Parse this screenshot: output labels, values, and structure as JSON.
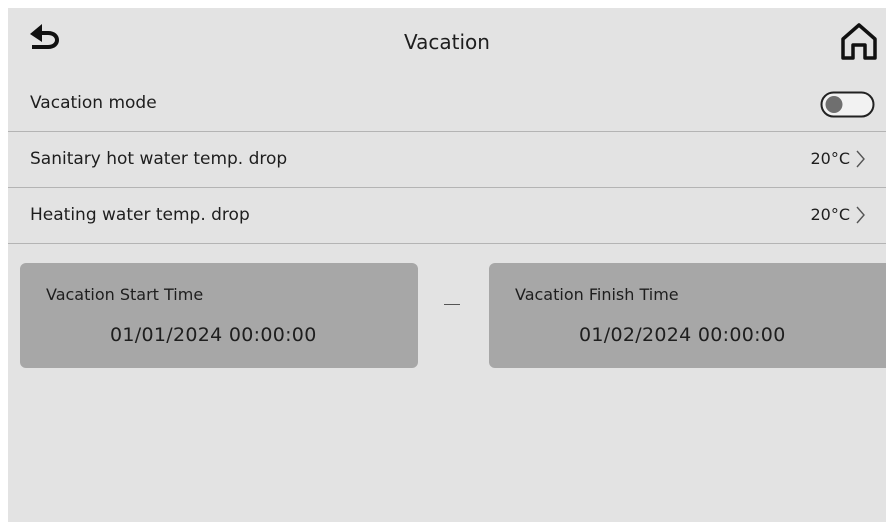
{
  "header": {
    "title": "Vacation",
    "back_icon": "back-arrow-icon",
    "home_icon": "home-icon"
  },
  "settings": [
    {
      "label": "Vacation mode",
      "type": "toggle",
      "enabled": false
    },
    {
      "label": "Sanitary hot water temp. drop",
      "value": "20°C",
      "type": "nav"
    },
    {
      "label": "Heating water temp. drop",
      "value": "20°C",
      "type": "nav"
    }
  ],
  "schedule": {
    "start": {
      "label": "Vacation Start Time",
      "value": "01/01/2024  00:00:00"
    },
    "separator": "—",
    "finish": {
      "label": "Vacation Finish Time",
      "value": "01/02/2024  00:00:00"
    }
  },
  "colors": {
    "background": "#e3e3e3",
    "card": "#a7a7a7",
    "divider": "#b4b4b4",
    "text": "#1e1e1e"
  }
}
